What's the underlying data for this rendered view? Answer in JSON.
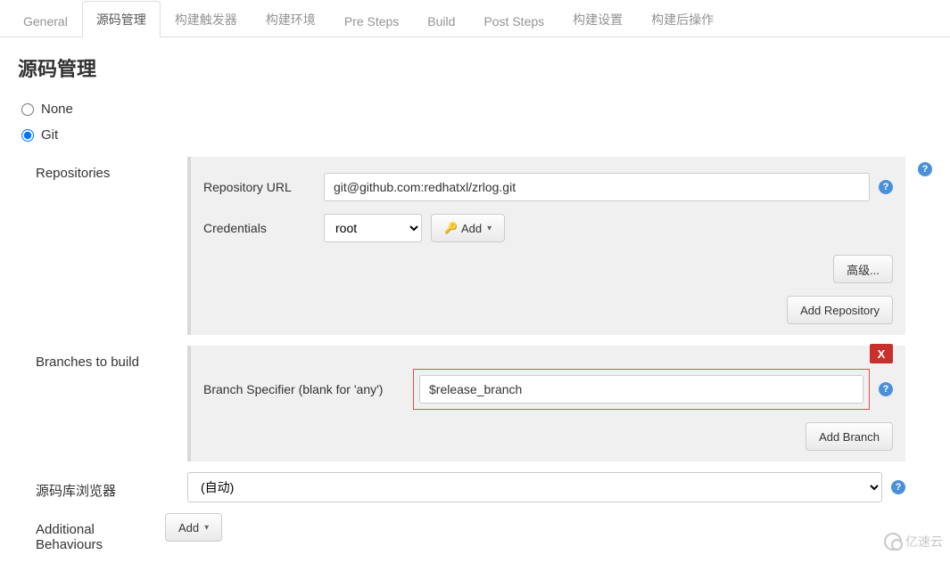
{
  "tabs": [
    {
      "label": "General",
      "active": false
    },
    {
      "label": "源码管理",
      "active": true
    },
    {
      "label": "构建触发器",
      "active": false
    },
    {
      "label": "构建环境",
      "active": false
    },
    {
      "label": "Pre Steps",
      "active": false
    },
    {
      "label": "Build",
      "active": false
    },
    {
      "label": "Post Steps",
      "active": false
    },
    {
      "label": "构建设置",
      "active": false
    },
    {
      "label": "构建后操作",
      "active": false
    }
  ],
  "section_title": "源码管理",
  "scm": {
    "options": [
      {
        "label": "None",
        "selected": false
      },
      {
        "label": "Git",
        "selected": true
      }
    ]
  },
  "repositories": {
    "label": "Repositories",
    "repo_url_label": "Repository URL",
    "repo_url_value": "git@github.com:redhatxl/zrlog.git",
    "credentials_label": "Credentials",
    "credentials_value": "root",
    "credentials_options": [
      "root"
    ],
    "add_credentials_label": "Add",
    "advanced_label": "高级...",
    "add_repo_label": "Add Repository"
  },
  "branches": {
    "label": "Branches to build",
    "specifier_label": "Branch Specifier (blank for 'any')",
    "specifier_value": "$release_branch",
    "delete_label": "X",
    "add_branch_label": "Add Branch"
  },
  "repo_browser": {
    "label": "源码库浏览器",
    "value": "(自动)"
  },
  "additional": {
    "label": "Additional Behaviours",
    "add_label": "Add"
  },
  "help_glyph": "?",
  "watermark": "亿速云"
}
